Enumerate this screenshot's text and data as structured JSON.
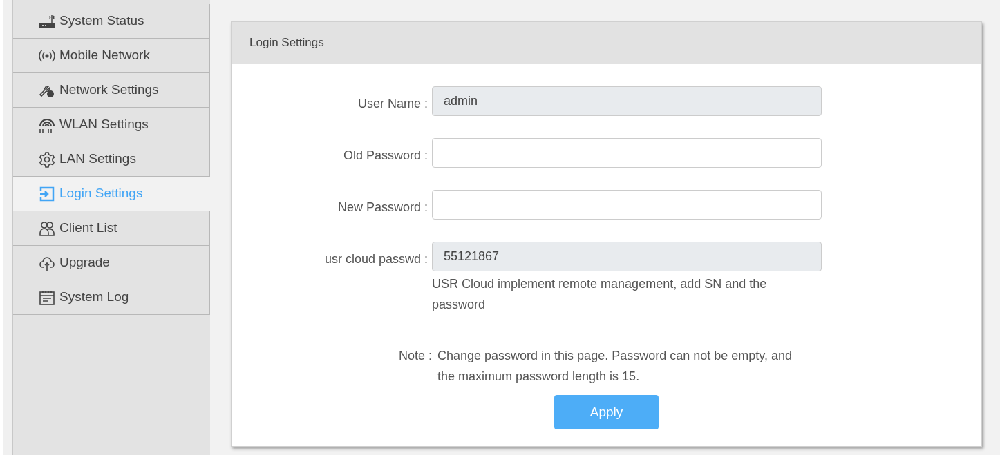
{
  "sidebar": {
    "items": [
      {
        "label": "System Status",
        "selected": false
      },
      {
        "label": "Mobile Network",
        "selected": false
      },
      {
        "label": "Network Settings",
        "selected": false
      },
      {
        "label": "WLAN Settings",
        "selected": false
      },
      {
        "label": "LAN Settings",
        "selected": false
      },
      {
        "label": "Login Settings",
        "selected": true
      },
      {
        "label": "Client List",
        "selected": false
      },
      {
        "label": "Upgrade",
        "selected": false
      },
      {
        "label": "System Log",
        "selected": false
      }
    ]
  },
  "panel": {
    "title": "Login Settings",
    "fields": [
      {
        "label": "User Name :",
        "value": "admin",
        "disabled": true
      },
      {
        "label": "Old Password :",
        "disabled": false
      },
      {
        "label": "New Password :",
        "disabled": false
      },
      {
        "label": "usr cloud passwd :",
        "value": "55121867",
        "disabled": true,
        "help": "USR Cloud implement remote management, add SN and the password"
      }
    ],
    "note_label": "Note :",
    "note": "Change password in this page. Password can not be empty, and the maximum password length is 15.",
    "button": "Apply"
  }
}
